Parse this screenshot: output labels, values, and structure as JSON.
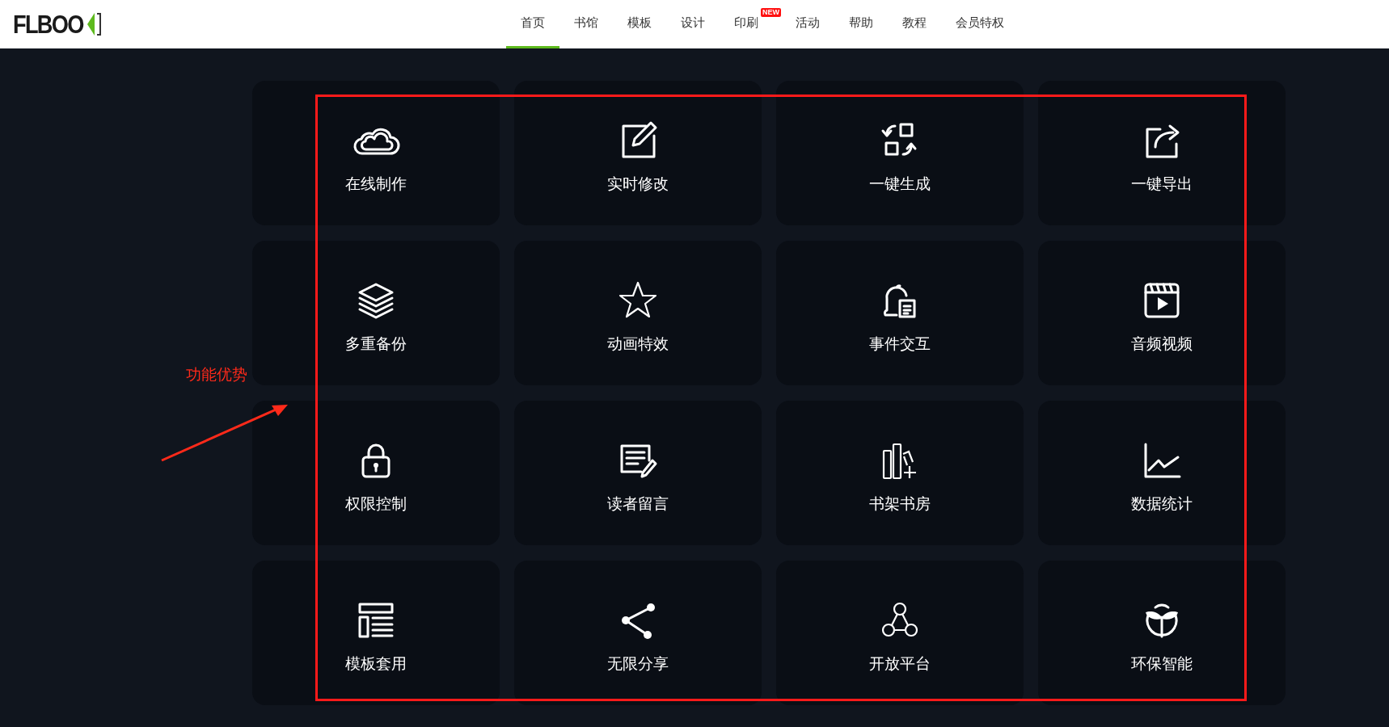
{
  "header": {
    "logo": "FLBOO",
    "nav": [
      {
        "label": "首页",
        "selected": true
      },
      {
        "label": "书馆",
        "selected": false
      },
      {
        "label": "模板",
        "selected": false
      },
      {
        "label": "设计",
        "selected": false
      },
      {
        "label": "印刷",
        "selected": false,
        "badge": "NEW"
      },
      {
        "label": "活动",
        "selected": false
      },
      {
        "label": "帮助",
        "selected": false
      },
      {
        "label": "教程",
        "selected": false
      },
      {
        "label": "会员特权",
        "selected": false
      }
    ]
  },
  "features": [
    {
      "label": "在线制作"
    },
    {
      "label": "实时修改"
    },
    {
      "label": "一键生成"
    },
    {
      "label": "一键导出"
    },
    {
      "label": "多重备份"
    },
    {
      "label": "动画特效"
    },
    {
      "label": "事件交互"
    },
    {
      "label": "音频视频"
    },
    {
      "label": "权限控制"
    },
    {
      "label": "读者留言"
    },
    {
      "label": "书架书房"
    },
    {
      "label": "数据统计"
    },
    {
      "label": "模板套用"
    },
    {
      "label": "无限分享"
    },
    {
      "label": "开放平台"
    },
    {
      "label": "环保智能"
    }
  ],
  "annotation": {
    "label": "功能优势"
  }
}
